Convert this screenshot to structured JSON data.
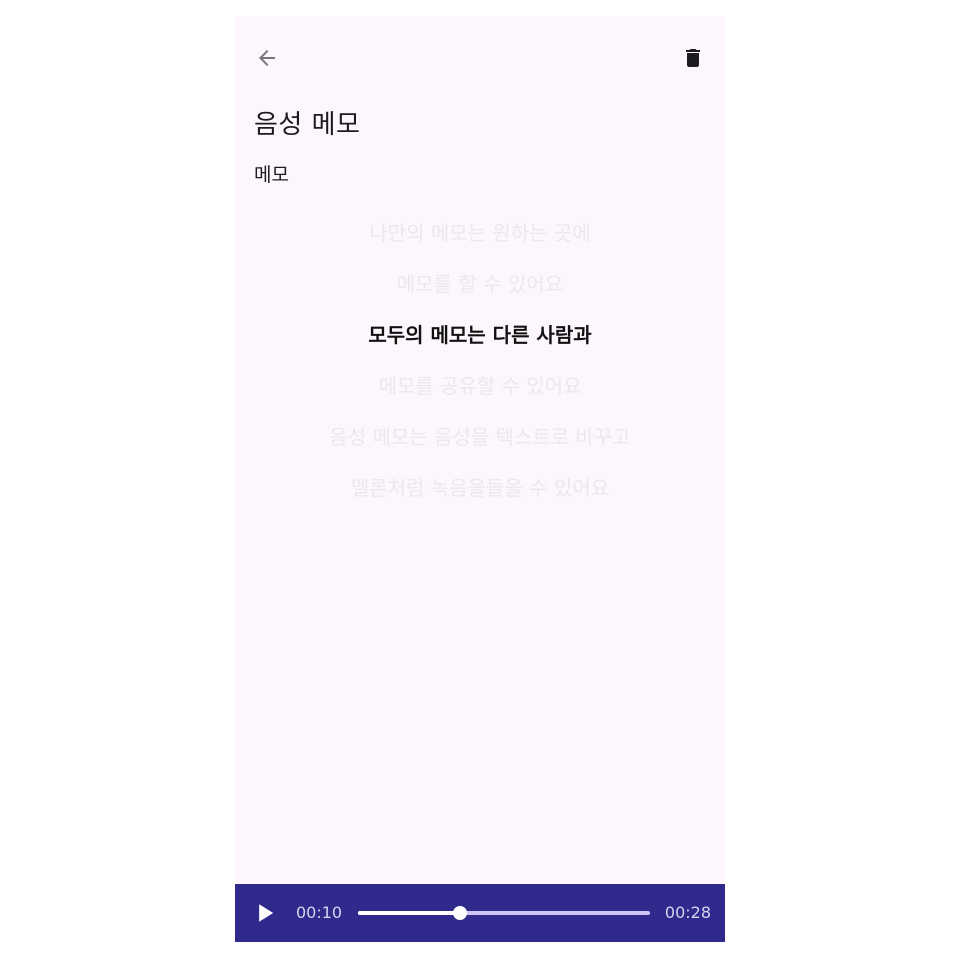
{
  "header": {
    "back_icon": "arrow-back-icon",
    "delete_icon": "trash-icon"
  },
  "title": "음성 메모",
  "section_label": "메모",
  "lyrics": [
    {
      "text": "나만의 메모는 원하는 곳에",
      "active": false
    },
    {
      "text": "메모를 할 수 있어요",
      "active": false
    },
    {
      "text": "모두의 메모는 다른 사람과",
      "active": true
    },
    {
      "text": "메모를 공유할 수 있어요",
      "active": false
    },
    {
      "text": "음성 메모는 음성을 텍스트로 바꾸고",
      "active": false
    },
    {
      "text": "멜론처럼 녹음을들을 수 있어요",
      "active": false
    }
  ],
  "player": {
    "play_icon": "play-icon",
    "current_time": "00:10",
    "total_time": "00:28",
    "progress": 0.35,
    "background_color": "#302a8c"
  }
}
